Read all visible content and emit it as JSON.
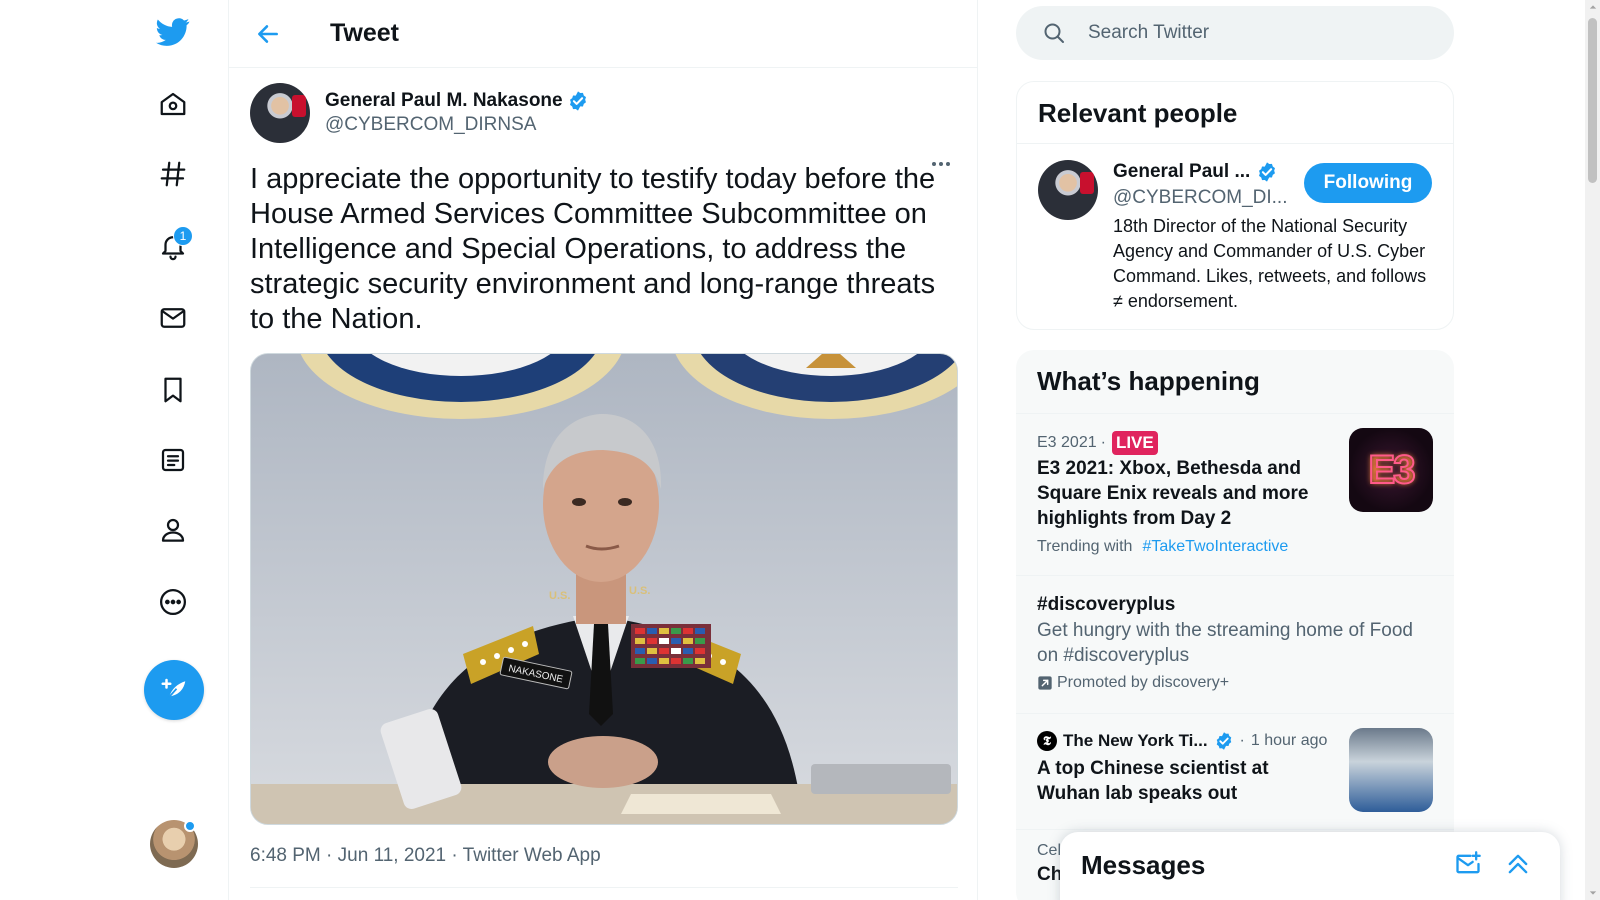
{
  "nav": {
    "items": [
      {
        "id": "home",
        "icon": "home-icon"
      },
      {
        "id": "explore",
        "icon": "hashtag-icon"
      },
      {
        "id": "notifications",
        "icon": "bell-icon",
        "badge": "1"
      },
      {
        "id": "messages",
        "icon": "mail-icon"
      },
      {
        "id": "bookmarks",
        "icon": "bookmark-icon"
      },
      {
        "id": "lists",
        "icon": "list-icon"
      },
      {
        "id": "profile",
        "icon": "person-icon"
      },
      {
        "id": "more",
        "icon": "more-circle-icon"
      }
    ]
  },
  "header": {
    "title": "Tweet"
  },
  "tweet": {
    "author_name": "General Paul M. Nakasone",
    "author_handle": "@CYBERCOM_DIRNSA",
    "text": "I appreciate the opportunity to testify today before the House Armed Services Committee Subcommittee on Intelligence and Special Operations, to address the strategic security environment and long-range threats to the Nation.",
    "time": "6:48 PM",
    "date": "Jun 11, 2021",
    "source": "Twitter Web App",
    "nameplate": "NAKASONE",
    "insignia": "U.S."
  },
  "search": {
    "placeholder": "Search Twitter"
  },
  "relevant_people": {
    "title": "Relevant people",
    "person": {
      "name": "General Paul ...",
      "handle": "@CYBERCOM_DI...",
      "follow_label": "Following",
      "bio": "18th Director of the National Security Agency and Commander of U.S. Cyber Command. Likes, retweets, and follows ≠ endorsement."
    }
  },
  "happening": {
    "title": "What’s happening",
    "trends": [
      {
        "category": "E3 2021",
        "live_label": "LIVE",
        "title": "E3 2021: Xbox, Bethesda and Square Enix reveals and more highlights from Day 2",
        "trending_with_label": "Trending with",
        "hashtag": "#TakeTwoInteractive",
        "thumb_text": "E3"
      },
      {
        "title": "#discoveryplus",
        "description": "Get hungry with the streaming home of Food on #discoveryplus",
        "promoted": "Promoted by discovery+"
      },
      {
        "source": "The New York Ti...",
        "time": "1 hour ago",
        "title": "A top Chinese scientist at Wuhan lab speaks out"
      }
    ],
    "partial_category": "Cel",
    "partial_title": "Ch"
  },
  "messages_drawer": {
    "title": "Messages"
  },
  "colors": {
    "accent": "#1d9bf0",
    "text": "#0f1419",
    "secondary": "#536471",
    "live": "#e0245e"
  }
}
